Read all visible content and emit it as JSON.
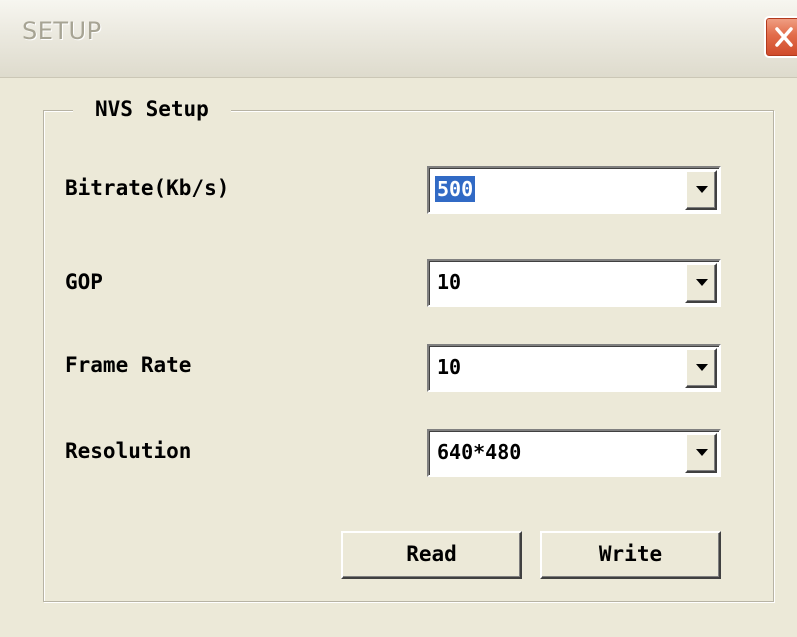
{
  "window": {
    "title": "SETUP",
    "close_icon": "close-icon"
  },
  "group": {
    "label": "NVS Setup"
  },
  "fields": {
    "bitrate": {
      "label": "Bitrate(Kb/s)",
      "value": "500"
    },
    "gop": {
      "label": "GOP",
      "value": "10"
    },
    "frame_rate": {
      "label": "Frame Rate",
      "value": "10"
    },
    "resolution": {
      "label": "Resolution",
      "value": "640*480"
    }
  },
  "buttons": {
    "read": "Read",
    "write": "Write"
  },
  "colors": {
    "face": "#ece9d8",
    "selection": "#316ac5",
    "close_red": "#e26c4a"
  }
}
